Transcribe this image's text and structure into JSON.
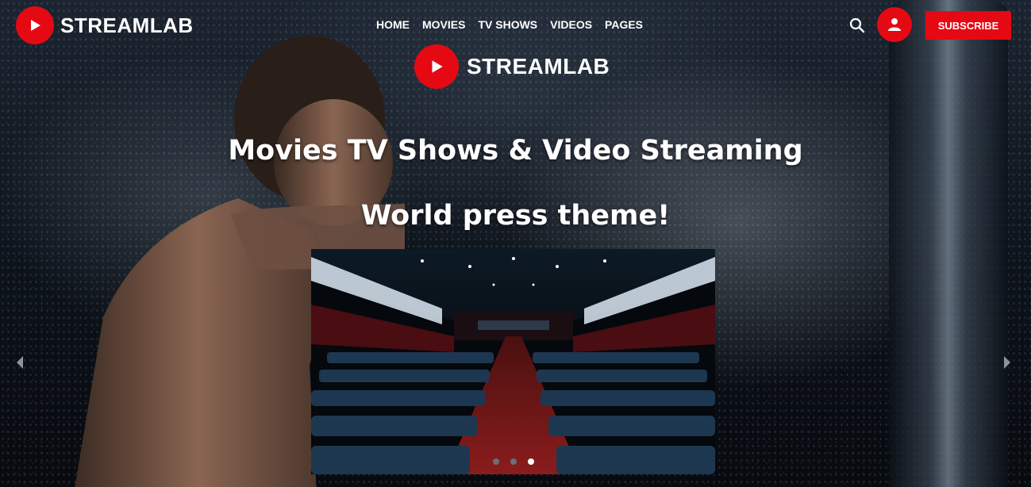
{
  "brand": {
    "name": "STREAMLAB",
    "accent_color": "#e50914"
  },
  "nav": {
    "items": [
      {
        "label": "HOME"
      },
      {
        "label": "MOVIES"
      },
      {
        "label": "TV SHOWS"
      },
      {
        "label": "VIDEOS"
      },
      {
        "label": "PAGES"
      }
    ]
  },
  "header_actions": {
    "search_icon": "search-icon",
    "user_icon": "user-icon",
    "subscribe_label": "SUBSCRIBE"
  },
  "hero": {
    "center_brand": "STREAMLAB",
    "headline_line1": "Movies TV Shows & Video Streaming",
    "headline_line2": "World press theme!",
    "slider": {
      "dots": [
        {
          "active": false
        },
        {
          "active": false
        },
        {
          "active": true
        }
      ]
    },
    "prev_icon": "chevron-left-icon",
    "next_icon": "chevron-right-icon"
  }
}
